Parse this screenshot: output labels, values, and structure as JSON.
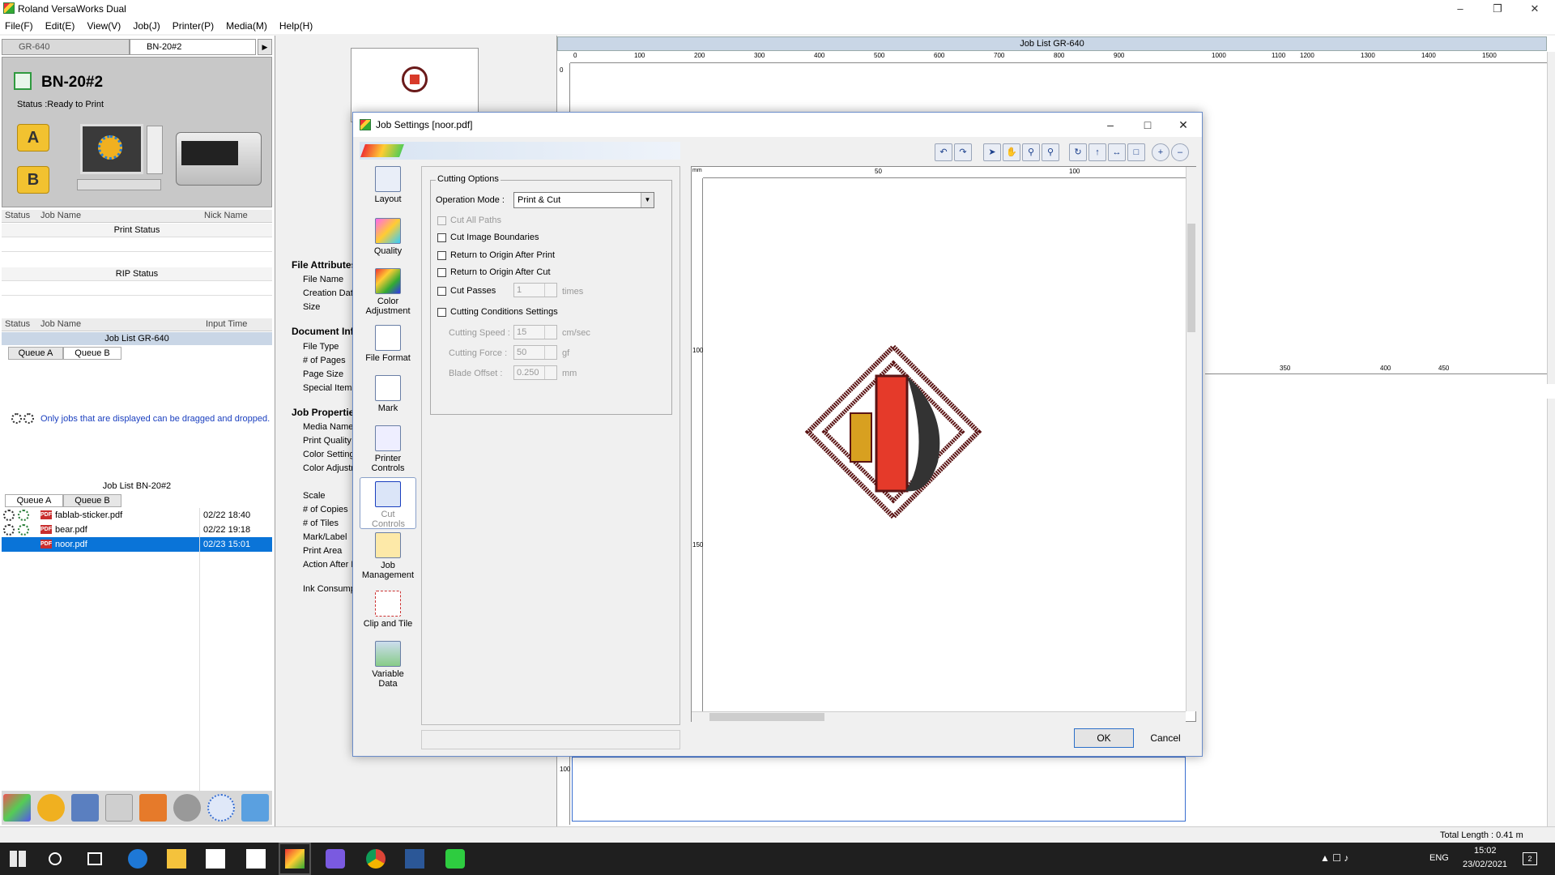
{
  "app": {
    "title": "Roland VersaWorks Dual",
    "menu": [
      "File(F)",
      "Edit(E)",
      "View(V)",
      "Job(J)",
      "Printer(P)",
      "Media(M)",
      "Help(H)"
    ]
  },
  "printers": {
    "tabs": [
      "GR-640",
      "BN-20#2"
    ],
    "selected": {
      "name": "BN-20#2",
      "status": "Status :Ready to Print"
    },
    "queue_badges": [
      "A",
      "B"
    ]
  },
  "job_table": {
    "headers": [
      "Status",
      "Job Name",
      "Nick Name"
    ],
    "print_status": "Print Status",
    "rip_status": "RIP Status"
  },
  "job_list_gr": {
    "headers": [
      "Status",
      "Job Name",
      "Input Time"
    ],
    "title": "Job List GR-640",
    "tabs": [
      "Queue A",
      "Queue B"
    ],
    "message": "Only jobs that are displayed can be dragged and dropped."
  },
  "job_list_bn": {
    "title": "Job List BN-20#2",
    "tabs": [
      "Queue A",
      "Queue B"
    ],
    "rows": [
      {
        "name": "fablab-sticker.pdf",
        "time": "02/22 18:40"
      },
      {
        "name": "bear.pdf",
        "time": "02/22 19:18"
      },
      {
        "name": "noor.pdf",
        "time": "02/23 15:01"
      }
    ]
  },
  "attributes": {
    "file_attributes": "File Attributes",
    "file_items": [
      "File Name",
      "Creation Dat",
      "Size"
    ],
    "document_info": "Document Inf",
    "doc_items": [
      "File Type",
      "# of Pages",
      "Page Size",
      "Special Items"
    ],
    "job_properties": "Job Propertie",
    "job_items": [
      "Media Name",
      "Print Quality",
      "Color Setting",
      "Color Adjustm",
      "",
      "Scale",
      "# of Copies",
      "# of Tiles",
      "Mark/Label",
      "Print Area",
      "Action After I",
      "",
      "Ink Consump"
    ]
  },
  "right_pane": {
    "job_list_title": "Job List GR-640",
    "ruler_top": [
      "0",
      "100",
      "200",
      "300",
      "400",
      "500",
      "600",
      "700",
      "800",
      "900",
      "1000",
      "1100",
      "1200",
      "1300",
      "1400",
      "1500"
    ],
    "ruler_mid": [
      "350",
      "400",
      "450"
    ],
    "ruler_left_top": "0",
    "ruler_left_bottom": "100",
    "total_length": "Total Length : 0.41 m"
  },
  "dialog": {
    "title": "Job Settings [noor.pdf]",
    "sidebar": [
      {
        "label": "Layout",
        "icon": "layout-icon"
      },
      {
        "label": "Quality",
        "icon": "quality-icon"
      },
      {
        "label": "Color Adjustment",
        "icon": "color-adjustment-icon"
      },
      {
        "label": "File Format",
        "icon": "file-format-icon"
      },
      {
        "label": "Mark",
        "icon": "mark-icon"
      },
      {
        "label": "Printer Controls",
        "icon": "printer-controls-icon"
      },
      {
        "label": "Cut Controls",
        "icon": "cut-controls-icon"
      },
      {
        "label": "Job Management",
        "icon": "job-management-icon"
      },
      {
        "label": "Clip and Tile",
        "icon": "clip-and-tile-icon"
      },
      {
        "label": "Variable Data",
        "icon": "variable-data-icon"
      }
    ],
    "cutting": {
      "group_title": "Cutting Options",
      "operation_mode_label": "Operation Mode :",
      "operation_mode_value": "Print & Cut",
      "cut_all_paths": "Cut All Paths",
      "cut_image_boundaries": "Cut Image Boundaries",
      "return_after_print": "Return to Origin After Print",
      "return_after_cut": "Return to Origin After Cut",
      "cut_passes": "Cut Passes",
      "cut_passes_value": "1",
      "cut_passes_unit": "times",
      "conditions": "Cutting Conditions Settings",
      "speed_label": "Cutting Speed :",
      "speed_value": "15",
      "speed_unit": "cm/sec",
      "force_label": "Cutting Force :",
      "force_value": "50",
      "force_unit": "gf",
      "offset_label": "Blade Offset :",
      "offset_value": "0.250",
      "offset_unit": "mm"
    },
    "preview": {
      "unit": "mm",
      "ruler_top": [
        "50",
        "100"
      ],
      "ruler_left": [
        "100",
        "150"
      ]
    },
    "ok": "OK",
    "cancel": "Cancel"
  },
  "taskbar": {
    "lang": "ENG",
    "time": "15:02",
    "date": "23/02/2021",
    "notifications": "2"
  }
}
